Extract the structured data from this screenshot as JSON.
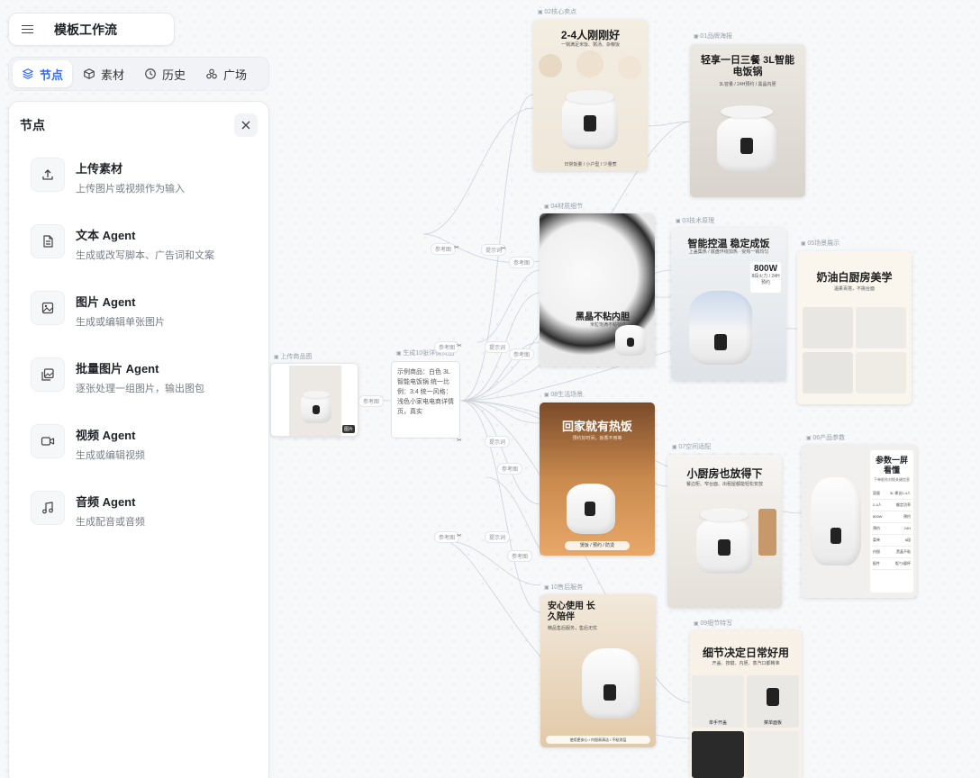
{
  "app": {
    "title": "模板工作流"
  },
  "tabs": [
    {
      "id": "nodes",
      "label": "节点",
      "icon": "layers-icon",
      "active": true
    },
    {
      "id": "materials",
      "label": "素材",
      "icon": "cube-icon",
      "active": false
    },
    {
      "id": "history",
      "label": "历史",
      "icon": "clock-icon",
      "active": false
    },
    {
      "id": "plaza",
      "label": "广场",
      "icon": "plaza-icon",
      "active": false
    }
  ],
  "panel": {
    "title": "节点",
    "items": [
      {
        "name": "upload",
        "title": "上传素材",
        "desc": "上传图片或视频作为输入",
        "icon": "upload-icon"
      },
      {
        "name": "text-agent",
        "title": "文本 Agent",
        "desc": "生成或改写脚本、广告词和文案",
        "icon": "document-icon"
      },
      {
        "name": "image-agent",
        "title": "图片 Agent",
        "desc": "生成或编辑单张图片",
        "icon": "image-icon"
      },
      {
        "name": "batch-image-agent",
        "title": "批量图片 Agent",
        "desc": "逐张处理一组图片，输出图包",
        "icon": "images-icon"
      },
      {
        "name": "video-agent",
        "title": "视频 Agent",
        "desc": "生成或编辑视频",
        "icon": "video-icon"
      },
      {
        "name": "audio-agent",
        "title": "音频 Agent",
        "desc": "生成配音或音频",
        "icon": "music-icon"
      }
    ]
  },
  "canvas": {
    "upload_node": {
      "label": "上传商品图",
      "badge": "图片"
    },
    "prompt_node": {
      "label": "生成10张详情页图",
      "text": "示例商品：白色 3L 智能电饭锅 统一比例：3:4 统一风格：浅色小家电电商详情页，真实"
    },
    "chips": {
      "reference": "参考图",
      "prompt": "提示词",
      "split": "参考图"
    },
    "cards": [
      {
        "label": "02核心卖点",
        "headline": "2-4人刚刚好",
        "sub": "一锅满足米饭、粥汤、杂粮饭",
        "footer": "日常饭量 / 小户型 / 少量煮"
      },
      {
        "label": "01品牌海报",
        "headline": "轻享一日三餐 3L智能电饭锅",
        "sub": "3L容量 / 24H预约 / 黑晶内胆"
      },
      {
        "label": "04材质细节",
        "headline": "黑晶不粘内胆",
        "sub": "米粒饱满不粘锅底"
      },
      {
        "label": "03技术原理",
        "headline": "智能控温 稳定成饭",
        "sub": "上盖集热 / 底盘环绕加热 · 受热一锅均匀",
        "spec": "800W",
        "spec2": "8段火力 / 24H预约"
      },
      {
        "label": "05场景展示",
        "headline": "奶油白厨房美学",
        "sub": "温柔百搭，不挑台面"
      },
      {
        "label": "08生活场景",
        "headline": "回家就有热饭",
        "sub": "预约好时间，饭香不用等",
        "footer": "煲饭 / 预约 / 防烫"
      },
      {
        "label": "07空间适配",
        "headline": "小厨房也放得下",
        "sub": "餐边柜、窄台面、出租屋都能轻松安放"
      },
      {
        "label": "06产品参数",
        "headline": "参数一屏看懂",
        "sub": "下单前先对照关键信息"
      },
      {
        "label": "10售后服务",
        "headline": "安心使用 长久陪伴",
        "sub": "精品售后服务，售后无忧",
        "footer": "使用更安心 / 内胆易清洁 / 不粘涂层"
      },
      {
        "label": "09细节特写",
        "headline": "细节决定日常好用",
        "sub": "开盖、按键、内胆、蒸汽口都精准",
        "detail1": "单手开盖",
        "detail2": "菜单面板"
      }
    ],
    "params": [
      [
        "容量",
        "3L 建议2-4人"
      ],
      [
        "2-4人",
        "额定功率"
      ],
      [
        "800W",
        "预约"
      ],
      [
        "预约",
        "24H"
      ],
      [
        "菜单",
        "8段"
      ],
      [
        "内胆",
        "黑晶不粘"
      ],
      [
        "配件",
        "饭勺/量杯"
      ]
    ],
    "colors": {
      "accent": "#2f6bff",
      "edge": "#c7ccd6"
    }
  }
}
